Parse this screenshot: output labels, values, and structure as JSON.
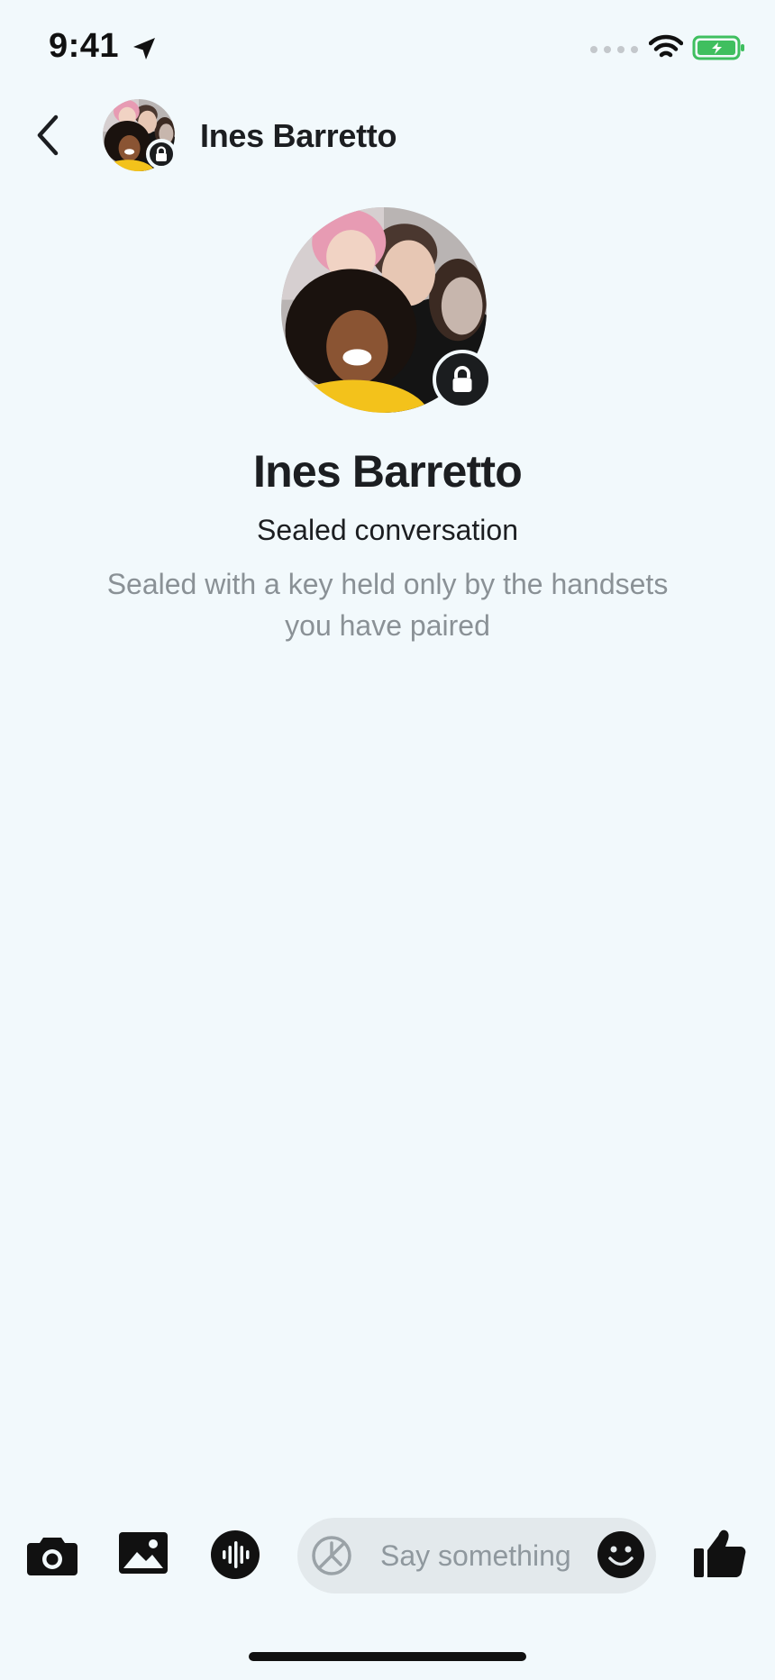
{
  "status_bar": {
    "time": "9:41",
    "icons": [
      "location-arrow-icon",
      "cellular-signal-icon",
      "wifi-icon",
      "battery-charging-icon"
    ],
    "battery_color": "#3fbf5f"
  },
  "header": {
    "back_icon": "chevron-left-icon",
    "title": "Ines Barretto",
    "avatar_badge_icon": "lock-icon"
  },
  "profile": {
    "name": "Ines Barretto",
    "subtitle": "Sealed conversation",
    "description": "Sealed with a key held only by the handsets you have paired",
    "badge_icon": "lock-icon"
  },
  "composer": {
    "buttons": [
      "camera-icon",
      "image-gallery-icon",
      "voice-waveform-icon"
    ],
    "timer_icon": "disappearing-timer-icon",
    "placeholder": "Say something",
    "emoji_icon": "smiley-icon",
    "send_icon": "thumbs-up-icon"
  },
  "colors": {
    "background": "#f2f9fc",
    "text_primary": "#1c1e21",
    "text_secondary": "#8a9196",
    "input_background": "#e3e9ec"
  }
}
